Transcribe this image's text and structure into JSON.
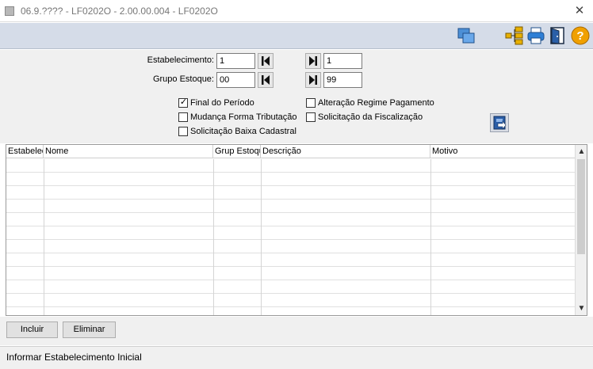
{
  "window": {
    "title": "06.9.???? - LF0202O - 2.00.00.004 - LF0202O",
    "close_glyph": "✕"
  },
  "toolbar": {
    "icons": [
      "windows-icon",
      "tree-icon",
      "print-icon",
      "exit-door-icon",
      "help-icon"
    ],
    "help_glyph": "?"
  },
  "filters": {
    "estabelecimento": {
      "label": "Estabelecimento:",
      "from": "1",
      "to": "1"
    },
    "grupo_estoque": {
      "label": "Grupo Estoque:",
      "from": "00",
      "to": "99"
    }
  },
  "checkboxes": {
    "final_periodo": {
      "label": "Final do Período",
      "checked": true
    },
    "mudanca_forma": {
      "label": "Mudança Forma Tributação",
      "checked": false
    },
    "solicitacao_baixa": {
      "label": "Solicitação Baixa Cadastral",
      "checked": false
    },
    "alteracao_regime": {
      "label": "Alteração Regime Pagamento",
      "checked": false
    },
    "solicitacao_fiscalizacao": {
      "label": "Solicitação da Fiscalização",
      "checked": false
    }
  },
  "grid": {
    "columns": [
      "Estabelecimento",
      "Nome",
      "Grup Estoque",
      "Descrição",
      "Motivo"
    ],
    "rows": []
  },
  "buttons": {
    "incluir": "Incluir",
    "eliminar": "Eliminar"
  },
  "status": {
    "text": "Informar Estabelecimento Inicial"
  },
  "colors": {
    "toolbar_bg": "#d5dce8",
    "panel_bg": "#f0f0f0",
    "help_orange": "#f0a000"
  }
}
